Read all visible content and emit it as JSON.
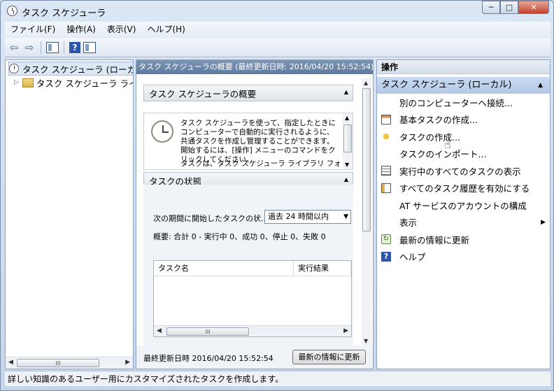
{
  "window": {
    "title": "タスク スケジューラ",
    "minimize": "─",
    "maximize": "□",
    "close": "✕"
  },
  "menu": [
    "ファイル(F)",
    "操作(A)",
    "表示(V)",
    "ヘルプ(H)"
  ],
  "toolbar": {
    "back": "⇦",
    "forward": "⇨",
    "help": "?"
  },
  "tree": {
    "root_label": "タスク スケジューラ (ローカル)",
    "child_label": "タスク スケジューラ ライブラリ",
    "expander": "▷",
    "scroll_thumb": "III"
  },
  "middle": {
    "header": "タスク スケジューラの概要 (最終更新日時: 2016/04/20 15:52:54)",
    "summary_title": "タスク スケジューラの概要",
    "summary_text": "タスク スケジューラを使って、指定したときにコンピューターで自動的に実行されるように、共通タスクを作成し管理することができます。開始するには、[操作] メニューのコマンドをクリックしてください。",
    "summary_text2": "タスクは、タスク スケジューラ ライブラリ フォルダ",
    "status_title": "タスクの状態",
    "status_label": "次の期間に開始したタスクの状...",
    "period_value": "過去 24 時間以内",
    "status_summary": "概要: 合計 0 - 実行中 0、成功 0、停止 0、失敗 0",
    "table_columns": [
      "タスク名",
      "実行結果"
    ],
    "table_scroll_thumb": "III",
    "footer_text": "最終更新日時 2016/04/20 15:52:54",
    "refresh_button": "最新の情報に更新"
  },
  "actions": {
    "header": "操作",
    "group_title": "タスク スケジューラ (ローカル)",
    "items": [
      {
        "label": "別のコンピューターへ接続...",
        "icon": "blank"
      },
      {
        "label": "基本タスクの作成...",
        "icon": "calendar"
      },
      {
        "label": "タスクの作成...",
        "icon": "sun"
      },
      {
        "label": "タスクのインポート...",
        "icon": "blank"
      },
      {
        "label": "実行中のすべてのタスクの表示",
        "icon": "list"
      },
      {
        "label": "すべてのタスク履歴を有効にする",
        "icon": "hist"
      },
      {
        "label": "AT サービスのアカウントの構成",
        "icon": "blank"
      },
      {
        "label": "表示",
        "icon": "blank"
      },
      {
        "label": "最新の情報に更新",
        "icon": "refresh"
      },
      {
        "label": "ヘルプ",
        "icon": "help"
      }
    ]
  },
  "statusbar": "詳しい知識のあるユーザー用にカスタマイズされたタスクを作成します。"
}
